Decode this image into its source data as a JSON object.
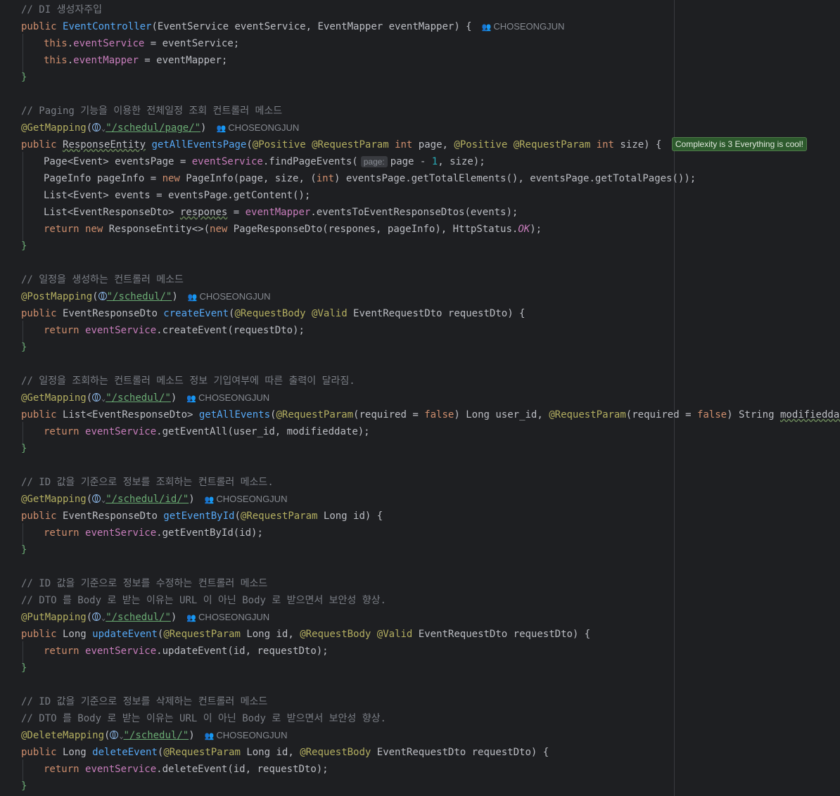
{
  "author": "CHOSEONGJUN",
  "complexity_badge": "Complexity is 3 Everything is cool!",
  "param_hint": "page:",
  "lines": {
    "c_di": "// DI 생성자주입",
    "c_paging": "// Paging 기능을 이용한 전체일정 조회 컨트롤러 메소드",
    "c_create": "// 일정을 생성하는 컨트롤러 메소드",
    "c_getall": "// 일정을 조회하는 컨트롤러 메소드 정보 기입여부에 따른 출력이 달라짐.",
    "c_getid": "// ID 값을 기준으로 정보를 조회하는 컨트롤러 메소드.",
    "c_update": "// ID 값을 기준으로 정보를 수정하는 컨트롤러 메소드",
    "c_dto": "// DTO 를 Body 로 받는 이유는 URL 이 아닌 Body 로 받으면서 보안성 향상.",
    "c_delete": "// ID 값을 기준으로 정보를 삭제하는 컨트롤러 메소드",
    "url_page": "\"/schedul/page/\"",
    "url_base": "\"/schedul/\"",
    "url_id": "\"/schedul/id/\""
  }
}
